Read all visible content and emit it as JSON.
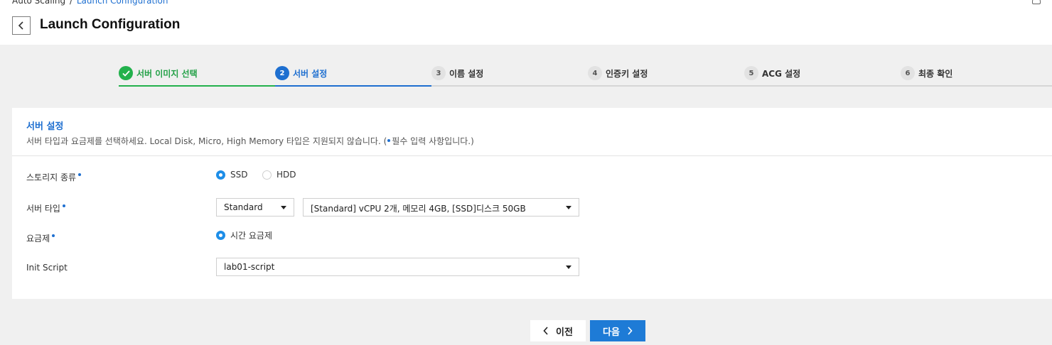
{
  "breadcrumb": {
    "parent": "Auto Scaling",
    "separator": "/",
    "current": "Launch Configuration"
  },
  "header": {
    "title": "Launch Configuration"
  },
  "steps": [
    {
      "number": "✓",
      "label": "서버 이미지 선택",
      "state": "done"
    },
    {
      "number": "2",
      "label": "서버 설정",
      "state": "active"
    },
    {
      "number": "3",
      "label": "이름 설정",
      "state": "todo"
    },
    {
      "number": "4",
      "label": "인증키 설정",
      "state": "todo"
    },
    {
      "number": "5",
      "label": "ACG 설정",
      "state": "todo"
    },
    {
      "number": "6",
      "label": "최종 확인",
      "state": "todo"
    }
  ],
  "section": {
    "title": "서버 설정",
    "desc_before": "서버 타입과 요금제를 선택하세요. Local Disk, Micro, High Memory 타입은 지원되지 않습니다. (",
    "desc_after": "필수 입력 사항입니다.)"
  },
  "form": {
    "storage": {
      "label": "스토리지 종류",
      "options": [
        {
          "label": "SSD",
          "checked": true
        },
        {
          "label": "HDD",
          "checked": false
        }
      ]
    },
    "server_type": {
      "label": "서버 타입",
      "type_value": "Standard",
      "spec_value": "[Standard] vCPU 2개, 메모리 4GB, [SSD]디스크 50GB"
    },
    "pricing": {
      "label": "요금제",
      "option": "시간 요금제"
    },
    "init_script": {
      "label": "Init Script",
      "value": "lab01-script"
    }
  },
  "buttons": {
    "prev": "이전",
    "next": "다음"
  },
  "colors": {
    "accent": "#1e6fd0",
    "done": "#22b14c",
    "primary_button": "#1e7bd6"
  }
}
